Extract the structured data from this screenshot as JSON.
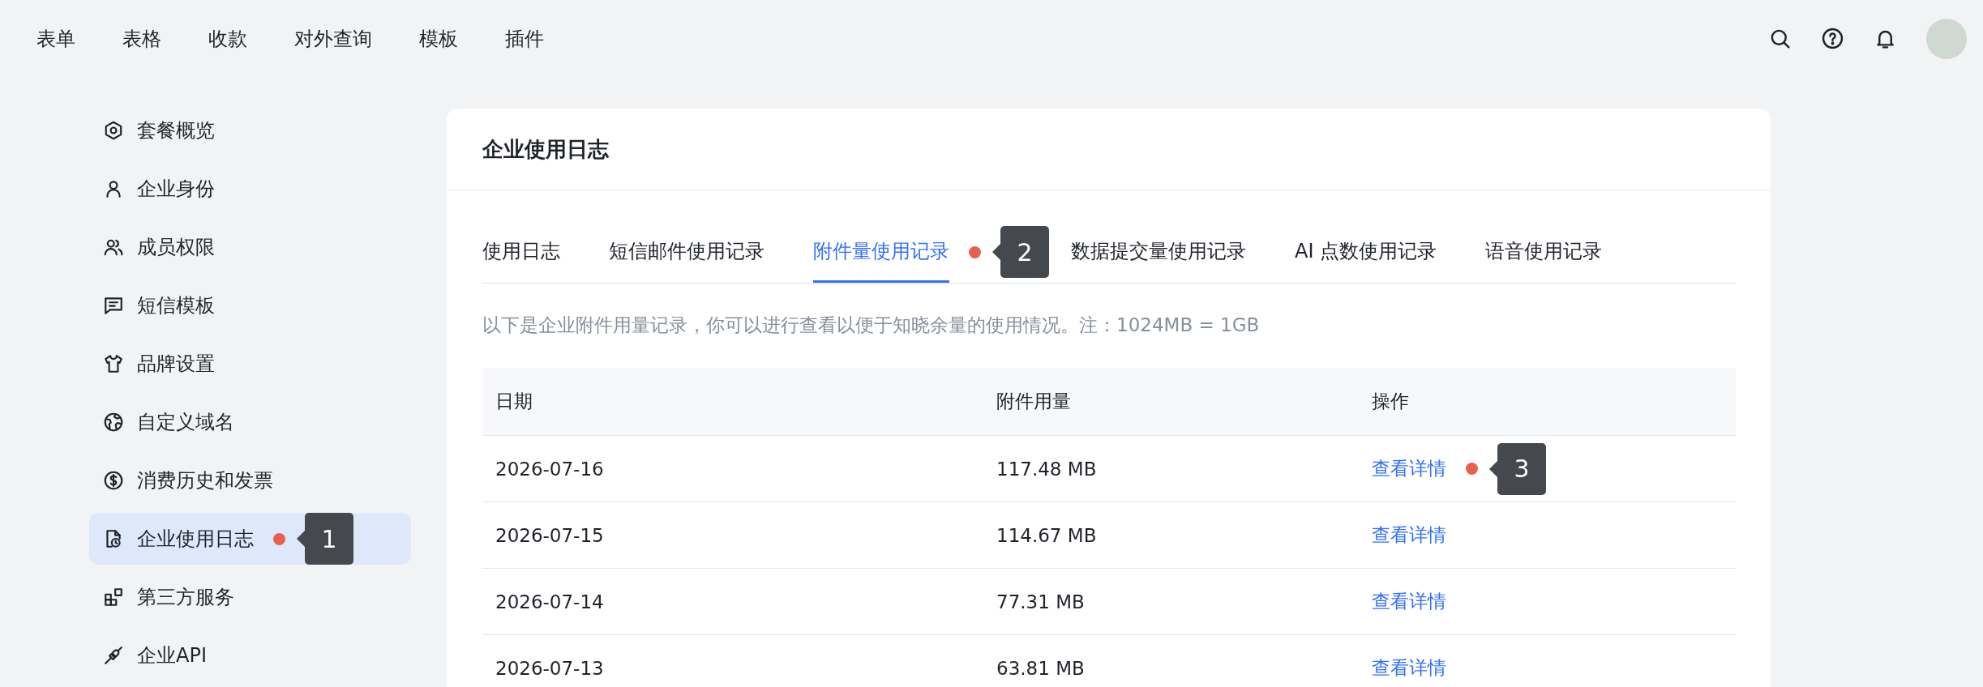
{
  "top_nav": {
    "items": [
      "表单",
      "表格",
      "收款",
      "对外查询",
      "模板",
      "插件"
    ]
  },
  "sidebar": {
    "items": [
      {
        "label": "套餐概览",
        "selected": false
      },
      {
        "label": "企业身份",
        "selected": false
      },
      {
        "label": "成员权限",
        "selected": false
      },
      {
        "label": "短信模板",
        "selected": false
      },
      {
        "label": "品牌设置",
        "selected": false
      },
      {
        "label": "自定义域名",
        "selected": false
      },
      {
        "label": "消费历史和发票",
        "selected": false
      },
      {
        "label": "企业使用日志",
        "selected": true,
        "callout": "1"
      },
      {
        "label": "第三方服务",
        "selected": false
      },
      {
        "label": "企业API",
        "selected": false
      }
    ]
  },
  "card": {
    "title": "企业使用日志",
    "tabs": [
      {
        "label": "使用日志",
        "selected": false
      },
      {
        "label": "短信邮件使用记录",
        "selected": false
      },
      {
        "label": "附件量使用记录",
        "selected": true,
        "callout": "2"
      },
      {
        "label": "数据提交量使用记录",
        "selected": false
      },
      {
        "label": "AI 点数使用记录",
        "selected": false
      },
      {
        "label": "语音使用记录",
        "selected": false
      }
    ],
    "description": "以下是企业附件用量记录，你可以进行查看以便于知晓余量的使用情况。注：1024MB = 1GB",
    "table": {
      "columns": [
        "日期",
        "附件用量",
        "操作"
      ],
      "rows": [
        {
          "date": "2026-07-16",
          "usage": "117.48 MB",
          "action": "查看详情",
          "callout": "3"
        },
        {
          "date": "2026-07-15",
          "usage": "114.67 MB",
          "action": "查看详情"
        },
        {
          "date": "2026-07-14",
          "usage": "77.31 MB",
          "action": "查看详情"
        },
        {
          "date": "2026-07-13",
          "usage": "63.81 MB",
          "action": "查看详情"
        }
      ]
    }
  }
}
